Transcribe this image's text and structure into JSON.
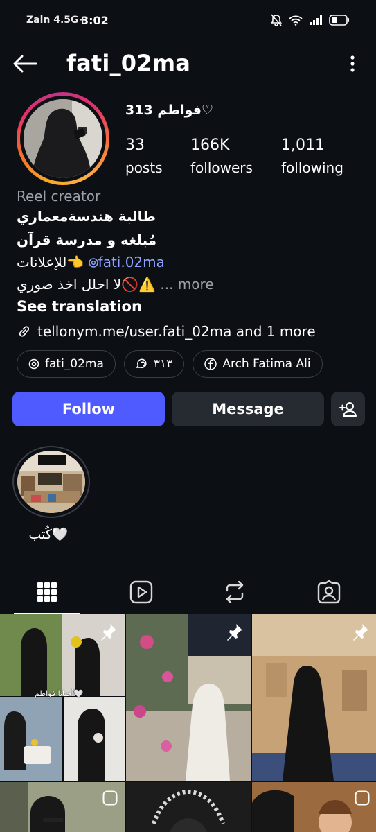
{
  "status_bar": {
    "carrier": "Zain 4.5G+",
    "time": "3:02"
  },
  "header": {
    "username": "fati_02ma"
  },
  "profile": {
    "display_name": "فواطم 313♡",
    "stats": [
      {
        "value": "33",
        "label": "posts"
      },
      {
        "value": "166K",
        "label": "followers"
      },
      {
        "value": "1,011",
        "label": "following"
      }
    ],
    "category": "Reel creator",
    "bio_line1": "طالبة هندسةمعماري",
    "bio_line2": "مُبلغه و مدرسة قرآن",
    "bio_line3_text": "للإعلانات👈",
    "bio_line3_mention": "fati.02ma",
    "bio_line4_text": "لا احلل اخذ صوري🚫⚠️",
    "bio_line4_more": "... more",
    "see_translation": "See translation",
    "link": "tellonym.me/user.fati_02ma and 1 more",
    "chips": [
      {
        "icon": "threads-icon",
        "label": "fati_02ma"
      },
      {
        "icon": "threads-bubble-icon",
        "label": "٣١٣"
      },
      {
        "icon": "facebook-icon",
        "label": "Arch Fatima Ali"
      }
    ]
  },
  "actions": {
    "follow_label": "Follow",
    "message_label": "Message"
  },
  "highlights": [
    {
      "label": "كُتب🤍"
    }
  ],
  "tabs": [
    "grid-icon",
    "reels-icon",
    "reposts-icon",
    "tagged-icon"
  ],
  "grid_overlay_text": "أحيانا فواطم🤍",
  "colors": {
    "background": "#0c0f14",
    "follow_button": "#4f5bff",
    "secondary_button": "#262a31",
    "mention_link": "#8fa2ff",
    "muted_text": "#9ba0a8"
  }
}
